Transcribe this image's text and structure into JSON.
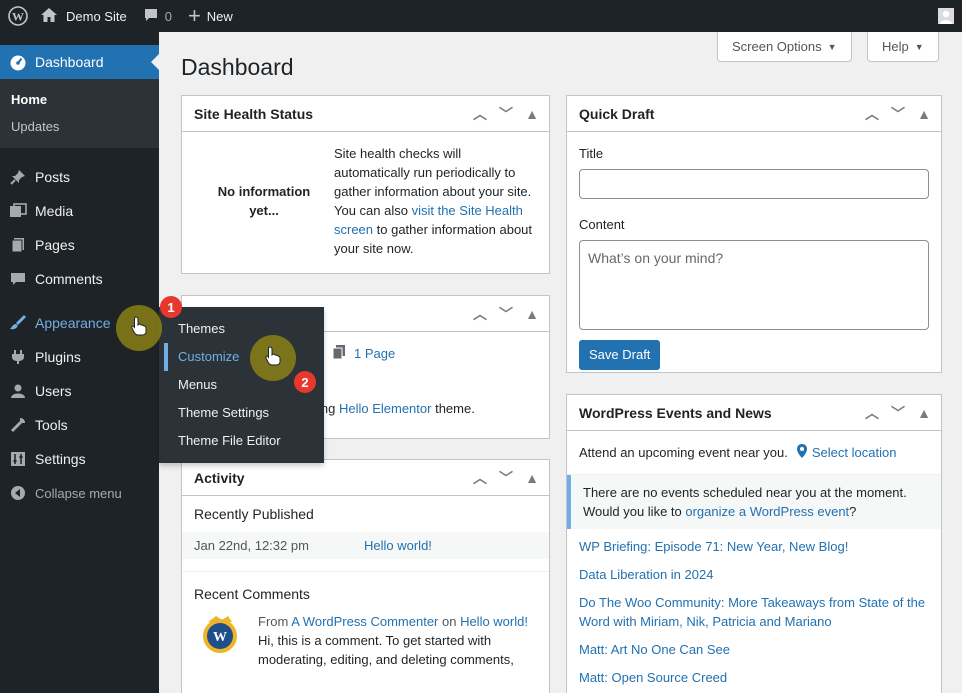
{
  "adminbar": {
    "site_name": "Demo Site",
    "comment_count": "0",
    "new_label": "New"
  },
  "sidebar": {
    "dashboard_label": "Dashboard",
    "sub_home": "Home",
    "sub_updates": "Updates",
    "items": [
      {
        "label": "Posts",
        "icon": "pin-icon"
      },
      {
        "label": "Media",
        "icon": "media-icon"
      },
      {
        "label": "Pages",
        "icon": "pages-icon"
      },
      {
        "label": "Comments",
        "icon": "comment-icon"
      },
      {
        "label": "Appearance",
        "icon": "brush-icon"
      },
      {
        "label": "Plugins",
        "icon": "plug-icon"
      },
      {
        "label": "Users",
        "icon": "user-icon"
      },
      {
        "label": "Tools",
        "icon": "wrench-icon"
      },
      {
        "label": "Settings",
        "icon": "settings-icon"
      }
    ],
    "collapse_label": "Collapse menu"
  },
  "flyout": {
    "items": [
      "Themes",
      "Customize",
      "Menus",
      "Theme Settings",
      "Theme File Editor"
    ]
  },
  "header": {
    "screen_options": "Screen Options",
    "help": "Help",
    "page_title": "Dashboard"
  },
  "site_health": {
    "title": "Site Health Status",
    "no_info": "No information yet...",
    "text_before": "Site health checks will automatically run periodically to gather information about your site. You can also ",
    "link": "visit the Site Health screen",
    "text_after": " to gather information about your site now."
  },
  "at_a_glance": {
    "page_count": "1 Page",
    "theme_text_start": "ing ",
    "theme_link": "Hello Elementor",
    "theme_text_end": " theme."
  },
  "activity": {
    "title": "Activity",
    "recently_published": "Recently Published",
    "post_date": "Jan 22nd, 12:32 pm",
    "post_title": "Hello world!",
    "recent_comments": "Recent Comments",
    "from": "From ",
    "commenter": "A WordPress Commenter",
    "on": " on ",
    "comment_post": "Hello world!",
    "comment_text": "Hi, this is a comment. To get started with moderating, editing, and deleting comments,"
  },
  "quick_draft": {
    "title": "Quick Draft",
    "title_label": "Title",
    "content_label": "Content",
    "content_placeholder": "What’s on your mind?",
    "save_button": "Save Draft"
  },
  "events": {
    "title": "WordPress Events and News",
    "intro": "Attend an upcoming event near you.",
    "select_location": "Select location",
    "notice_start": "There are no events scheduled near you at the moment. Would you like to ",
    "notice_link": "organize a WordPress event",
    "notice_end": "?",
    "news": [
      "WP Briefing: Episode 71: New Year, New Blog!",
      "Data Liberation in 2024",
      "Do The Woo Community: More Takeaways from State of the Word with Miriam, Nik, Patricia and Mariano",
      "Matt: Art No One Can See",
      "Matt: Open Source Creed"
    ]
  },
  "steps": [
    "1",
    "2"
  ],
  "colors": {
    "accent": "#2271b1",
    "admin_dark": "#1d2327",
    "hover_blue": "#72aee6",
    "step_red": "#e8382e",
    "cursor_ring": "#8c8214"
  }
}
